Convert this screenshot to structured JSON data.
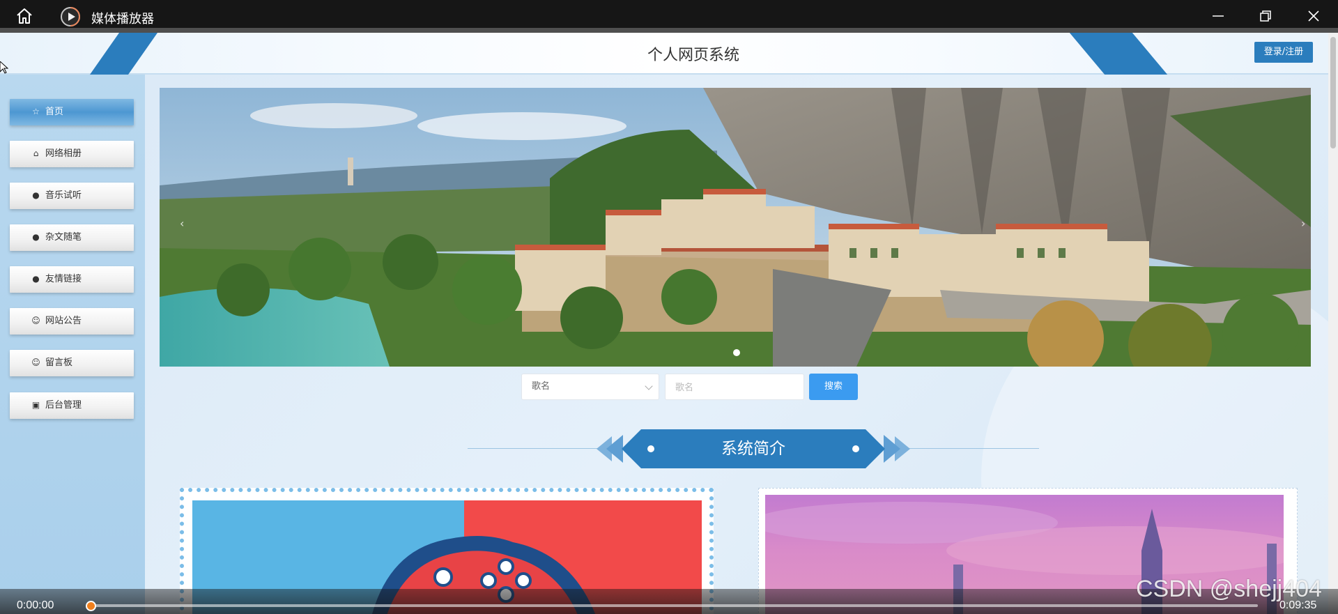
{
  "window": {
    "app_title": "媒体播放器"
  },
  "site": {
    "title": "个人网页系统",
    "login_label": "登录/注册"
  },
  "sidebar": {
    "items": [
      {
        "label": "首页",
        "icon": "star-icon",
        "active": true
      },
      {
        "label": "网络相册",
        "icon": "bag-icon",
        "active": false
      },
      {
        "label": "音乐试听",
        "icon": "info-icon",
        "active": false
      },
      {
        "label": "杂文随笔",
        "icon": "question-icon",
        "active": false
      },
      {
        "label": "友情链接",
        "icon": "info-icon",
        "active": false
      },
      {
        "label": "网站公告",
        "icon": "smile-icon",
        "active": false
      },
      {
        "label": "留言板",
        "icon": "smile-icon",
        "active": false
      },
      {
        "label": "后台管理",
        "icon": "gift-icon",
        "active": false
      }
    ]
  },
  "carousel": {
    "prev_glyph": "‹",
    "next_glyph": "›"
  },
  "search": {
    "select_value": "歌名",
    "input_placeholder": "歌名",
    "button_label": "搜索"
  },
  "section": {
    "title": "系统简介"
  },
  "player": {
    "current_time": "0:00:00",
    "total_time": "0:09:35",
    "progress": 0.0
  },
  "watermark": "CSDN @shejj404",
  "colors": {
    "accent_blue": "#2b7dbd",
    "search_button": "#3b9bf0",
    "progress_knob": "#f0801e"
  }
}
